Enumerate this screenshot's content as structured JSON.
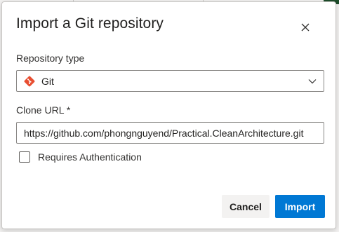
{
  "dialog": {
    "title": "Import a Git repository",
    "close_icon": "close-icon"
  },
  "repository_type": {
    "label": "Repository type",
    "selected": "Git",
    "icon": "git-icon",
    "icon_color": "#e84e31"
  },
  "clone_url": {
    "label": "Clone URL *",
    "value": "https://github.com/phongnguyend/Practical.CleanArchitecture.git"
  },
  "auth": {
    "label": "Requires Authentication",
    "checked": false
  },
  "buttons": {
    "cancel": "Cancel",
    "import": "Import"
  },
  "colors": {
    "accent": "#0078d4"
  }
}
